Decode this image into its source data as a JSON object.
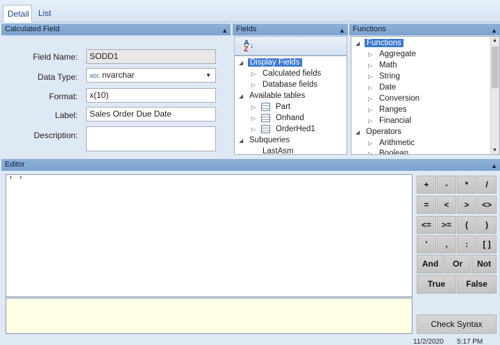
{
  "tabs": {
    "detail": "Detail",
    "list": "List"
  },
  "calc_panel": {
    "title": "Calculated Field",
    "field_name_label": "Field Name:",
    "field_name_value": "SODD1",
    "data_type_label": "Data Type:",
    "data_type_prefix": "abc",
    "data_type_value": "nvarchar",
    "format_label": "Format:",
    "format_value": "x(10)",
    "label_label": "Label:",
    "label_value": "Sales Order Due Date",
    "description_label": "Description:",
    "description_value": ""
  },
  "fields_panel": {
    "title": "Fields",
    "sort_icon": "sort-az-icon",
    "nodes": {
      "display_fields": "Display Fields",
      "calculated_fields": "Calculated fields",
      "database_fields": "Database fields",
      "available_tables": "Available tables",
      "part": "Part",
      "onhand": "Onhand",
      "orderhed1": "OrderHed1",
      "subqueries": "Subqueries",
      "lastasm": "LastAsm"
    }
  },
  "functions_panel": {
    "title": "Functions",
    "nodes": {
      "functions": "Functions",
      "aggregate": "Aggregate",
      "math": "Math",
      "string": "String",
      "date": "Date",
      "conversion": "Conversion",
      "ranges": "Ranges",
      "financial": "Financial",
      "operators": "Operators",
      "arithmetic": "Arithmetic",
      "boolean": "Boolean"
    }
  },
  "editor": {
    "title": "Editor",
    "expression": "' '"
  },
  "keypad": {
    "plus": "+",
    "minus": "-",
    "times": "*",
    "divide": "/",
    "eq": "=",
    "lt": "<",
    "gt": ">",
    "ne": "<>",
    "le": "<=",
    "ge": ">=",
    "lparen": "(",
    "rparen": ")",
    "quote": "'",
    "comma": ",",
    "colon": ":",
    "brackets": "[ ]",
    "and": "And",
    "or": "Or",
    "not": "Not",
    "true": "True",
    "false": "False",
    "check_syntax": "Check Syntax"
  },
  "status": {
    "date": "11/2/2020",
    "time": "5:17 PM"
  },
  "colors": {
    "header": "#8fb1d9",
    "selection": "#3a79d5",
    "editor_bg": "#ffffe6"
  }
}
